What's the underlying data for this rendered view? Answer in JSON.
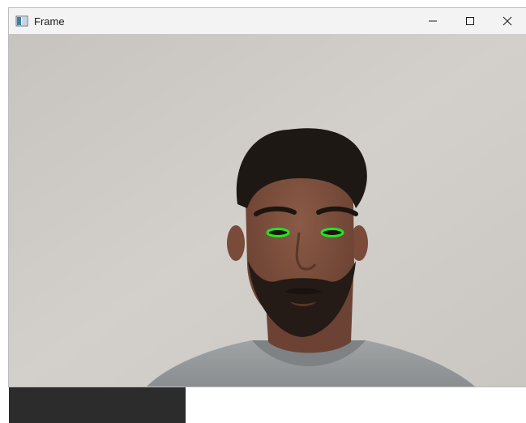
{
  "window": {
    "title": "Frame",
    "controls": {
      "minimize_icon": "minimize-icon",
      "maximize_icon": "maximize-icon",
      "close_icon": "close-icon"
    }
  },
  "video_feed": {
    "content": "webcam-frame",
    "overlay_color": "#22e622",
    "eye_contours": [
      "left-eye-contour",
      "right-eye-contour"
    ]
  },
  "colors": {
    "titlebar": "#f3f3f3",
    "wall": "#cfcbc7",
    "taskbar": "#2c2c2c"
  }
}
